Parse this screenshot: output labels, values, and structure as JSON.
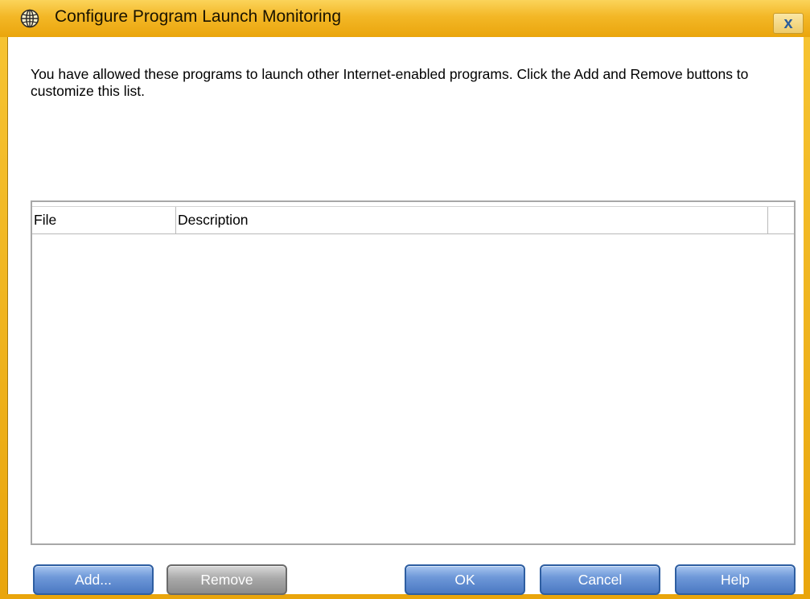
{
  "window": {
    "title": "Configure Program Launch Monitoring",
    "close_glyph": "x",
    "icon": "globe-icon",
    "frame_color": "#f0b31c"
  },
  "message": "You have allowed these programs to launch other Internet-enabled programs. Click the Add and Remove buttons to customize this list.",
  "list": {
    "columns": [
      "File",
      "Description",
      ""
    ],
    "rows": []
  },
  "buttons": {
    "add": "Add...",
    "remove": "Remove",
    "ok": "OK",
    "cancel": "Cancel",
    "help": "Help"
  }
}
